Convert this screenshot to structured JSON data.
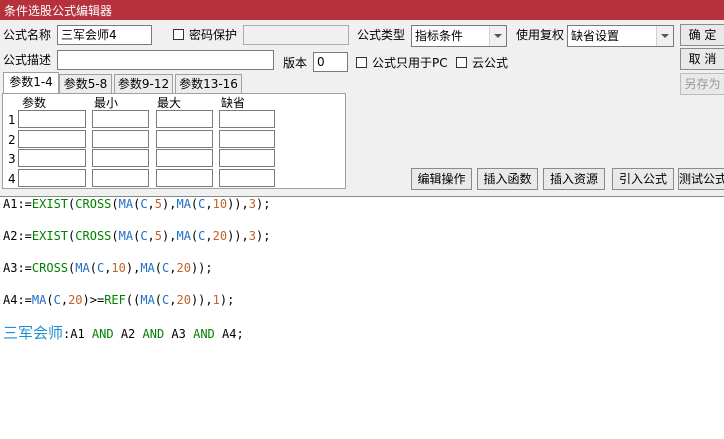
{
  "window": {
    "title": "条件选股公式编辑器"
  },
  "form": {
    "name_label": "公式名称",
    "name_value": "三军会师4",
    "password_label": "密码保护",
    "password_value": "",
    "type_label": "公式类型",
    "type_value": "指标条件",
    "fuquan_label": "使用复权",
    "fuquan_value": "缺省设置",
    "desc_label": "公式描述",
    "desc_value": "",
    "version_label": "版本",
    "version_value": "0",
    "pc_only_label": "公式只用于PC",
    "cloud_label": "云公式"
  },
  "buttons": {
    "ok": "确  定",
    "cancel": "取  消",
    "saveas": "另存为",
    "edit_ops": "编辑操作",
    "insert_func": "插入函数",
    "insert_res": "插入资源",
    "import_formula": "引入公式",
    "test_formula": "测试公式"
  },
  "tabs": [
    "参数1-4",
    "参数5-8",
    "参数9-12",
    "参数13-16"
  ],
  "param_headers": [
    "参数",
    "最小",
    "最大",
    "缺省"
  ],
  "param_rows": [
    "1",
    "2",
    "3",
    "4"
  ],
  "code": {
    "l1": [
      {
        "t": "A1:=",
        "c": "k"
      },
      {
        "t": "EXIST",
        "c": "g"
      },
      {
        "t": "(",
        "c": "k"
      },
      {
        "t": "CROSS",
        "c": "g"
      },
      {
        "t": "(",
        "c": "k"
      },
      {
        "t": "MA",
        "c": "b"
      },
      {
        "t": "(",
        "c": "k"
      },
      {
        "t": "C",
        "c": "b"
      },
      {
        "t": ",",
        "c": "k"
      },
      {
        "t": "5",
        "c": "r"
      },
      {
        "t": "),",
        "c": "k"
      },
      {
        "t": "MA",
        "c": "b"
      },
      {
        "t": "(",
        "c": "k"
      },
      {
        "t": "C",
        "c": "b"
      },
      {
        "t": ",",
        "c": "k"
      },
      {
        "t": "10",
        "c": "r"
      },
      {
        "t": ")),",
        "c": "k"
      },
      {
        "t": "3",
        "c": "r"
      },
      {
        "t": ");",
        "c": "k"
      }
    ],
    "l2": [
      {
        "t": "A2:=",
        "c": "k"
      },
      {
        "t": "EXIST",
        "c": "g"
      },
      {
        "t": "(",
        "c": "k"
      },
      {
        "t": "CROSS",
        "c": "g"
      },
      {
        "t": "(",
        "c": "k"
      },
      {
        "t": "MA",
        "c": "b"
      },
      {
        "t": "(",
        "c": "k"
      },
      {
        "t": "C",
        "c": "b"
      },
      {
        "t": ",",
        "c": "k"
      },
      {
        "t": "5",
        "c": "r"
      },
      {
        "t": "),",
        "c": "k"
      },
      {
        "t": "MA",
        "c": "b"
      },
      {
        "t": "(",
        "c": "k"
      },
      {
        "t": "C",
        "c": "b"
      },
      {
        "t": ",",
        "c": "k"
      },
      {
        "t": "20",
        "c": "r"
      },
      {
        "t": ")),",
        "c": "k"
      },
      {
        "t": "3",
        "c": "r"
      },
      {
        "t": ");",
        "c": "k"
      }
    ],
    "l3": [
      {
        "t": "A3:=",
        "c": "k"
      },
      {
        "t": "CROSS",
        "c": "g"
      },
      {
        "t": "(",
        "c": "k"
      },
      {
        "t": "MA",
        "c": "b"
      },
      {
        "t": "(",
        "c": "k"
      },
      {
        "t": "C",
        "c": "b"
      },
      {
        "t": ",",
        "c": "k"
      },
      {
        "t": "10",
        "c": "r"
      },
      {
        "t": "),",
        "c": "k"
      },
      {
        "t": "MA",
        "c": "b"
      },
      {
        "t": "(",
        "c": "k"
      },
      {
        "t": "C",
        "c": "b"
      },
      {
        "t": ",",
        "c": "k"
      },
      {
        "t": "20",
        "c": "r"
      },
      {
        "t": "));",
        "c": "k"
      }
    ],
    "l4": [
      {
        "t": "A4:=",
        "c": "k"
      },
      {
        "t": "MA",
        "c": "b"
      },
      {
        "t": "(",
        "c": "k"
      },
      {
        "t": "C",
        "c": "b"
      },
      {
        "t": ",",
        "c": "k"
      },
      {
        "t": "20",
        "c": "r"
      },
      {
        "t": ")>=",
        "c": "k"
      },
      {
        "t": "REF",
        "c": "g"
      },
      {
        "t": "((",
        "c": "k"
      },
      {
        "t": "MA",
        "c": "b"
      },
      {
        "t": "(",
        "c": "k"
      },
      {
        "t": "C",
        "c": "b"
      },
      {
        "t": ",",
        "c": "k"
      },
      {
        "t": "20",
        "c": "r"
      },
      {
        "t": ")),",
        "c": "k"
      },
      {
        "t": "1",
        "c": "r"
      },
      {
        "t": ");",
        "c": "k"
      }
    ],
    "l5": [
      {
        "t": "三军会师",
        "c": "cn"
      },
      {
        "t": ":A1 ",
        "c": "k"
      },
      {
        "t": "AND",
        "c": "g"
      },
      {
        "t": " A2 ",
        "c": "k"
      },
      {
        "t": "AND",
        "c": "g"
      },
      {
        "t": " A3 ",
        "c": "k"
      },
      {
        "t": "AND",
        "c": "g"
      },
      {
        "t": " A4;",
        "c": "k"
      }
    ]
  },
  "colors": {
    "titlebar": "#b5323d",
    "keyword_green": "#008000",
    "func_blue": "#1e6bc8",
    "number_orange": "#c0612b",
    "chinese_name": "#1e8fd0"
  }
}
